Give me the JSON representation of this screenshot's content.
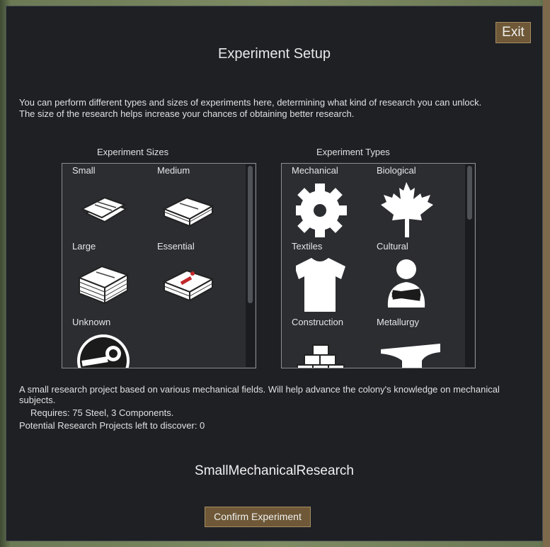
{
  "dialog": {
    "title": "Experiment Setup",
    "exit_label": "Exit",
    "intro_line1": "You can perform different types and sizes of experiments here, determining what kind of research you can unlock.",
    "intro_line2": "The size of the research helps increase your chances of obtaining better research."
  },
  "sizes": {
    "heading": "Experiment Sizes",
    "items": [
      {
        "label": "Small",
        "icon": "small-papers-icon"
      },
      {
        "label": "Medium",
        "icon": "medium-papers-icon"
      },
      {
        "label": "Large",
        "icon": "large-papers-icon"
      },
      {
        "label": "Essential",
        "icon": "essential-papers-icon"
      },
      {
        "label": "Unknown",
        "icon": "unknown-icon"
      }
    ]
  },
  "types": {
    "heading": "Experiment Types",
    "items": [
      {
        "label": "Mechanical",
        "icon": "gear-icon"
      },
      {
        "label": "Biological",
        "icon": "leaf-icon"
      },
      {
        "label": "Textiles",
        "icon": "shirt-icon"
      },
      {
        "label": "Cultural",
        "icon": "person-icon"
      },
      {
        "label": "Construction",
        "icon": "bricks-icon"
      },
      {
        "label": "Metallurgy",
        "icon": "anvil-icon"
      }
    ]
  },
  "details": {
    "description": "A small research project based on various mechanical fields. Will help advance the colony's knowledge on mechanical subjects.",
    "requires": "Requires: 75 Steel, 3 Components.",
    "remaining": "Potential Research Projects left to discover: 0",
    "selected_project": "SmallMechanicalResearch"
  },
  "confirm_label": "Confirm Experiment",
  "colors": {
    "dialog_bg": "#1e2024",
    "panel_bg": "#2b2d31",
    "button_bg": "#6e5837",
    "button_border": "#a58c63",
    "text": "#e6e6e6"
  }
}
